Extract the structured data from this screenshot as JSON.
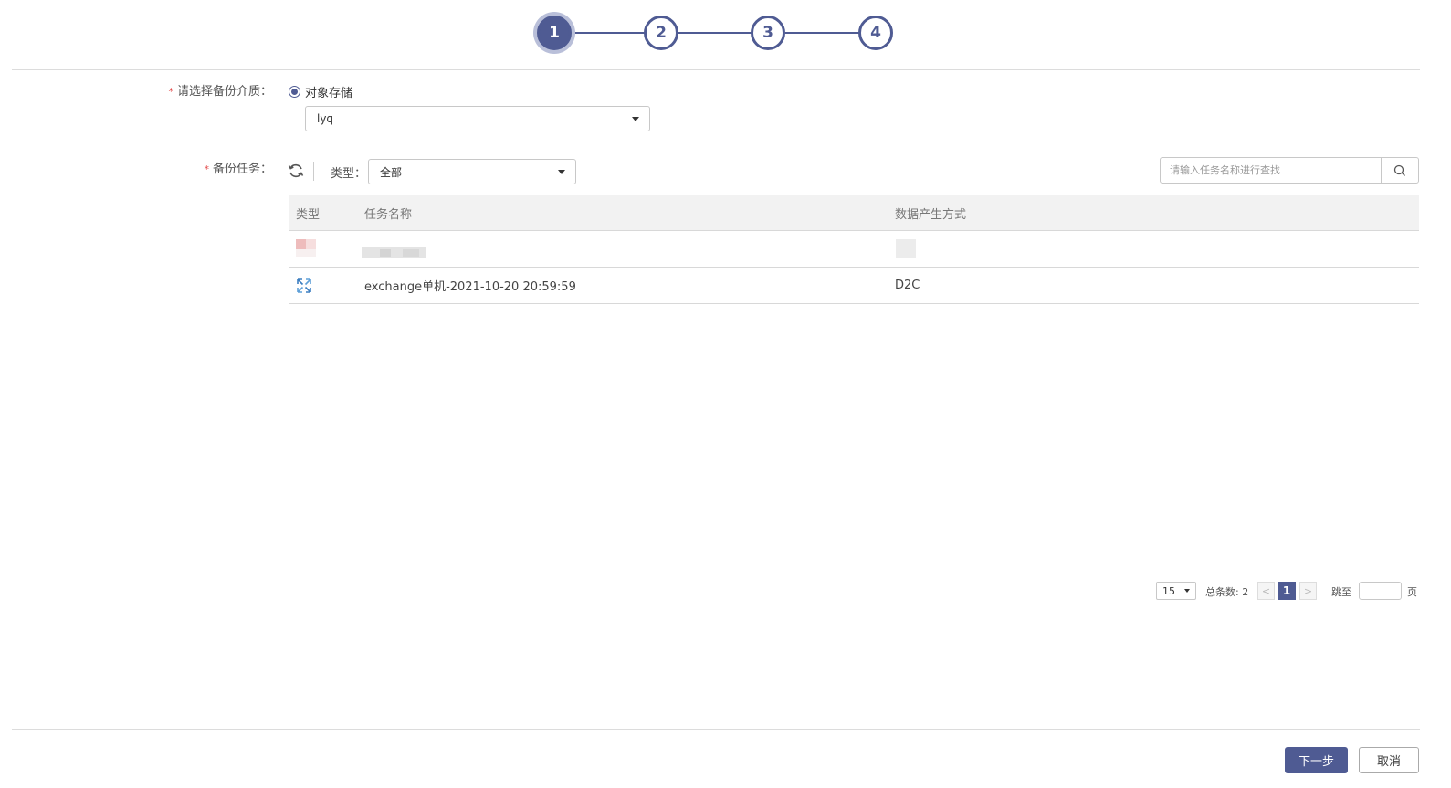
{
  "stepper": {
    "steps": [
      "1",
      "2",
      "3",
      "4"
    ],
    "active_step": 1
  },
  "medium": {
    "label": "请选择备份介质：",
    "required_mark": "*",
    "radio_label": "对象存储",
    "storage_value": "lyq"
  },
  "tasks": {
    "label": "备份任务：",
    "required_mark": "*",
    "type_label": "类型：",
    "type_value": "全部",
    "search_placeholder": "请输入任务名称进行查找"
  },
  "table": {
    "columns": [
      "类型",
      "任务名称",
      "数据产生方式"
    ],
    "rows": [
      {
        "type_icon": "redacted-icon",
        "name": "",
        "mode": ""
      },
      {
        "type_icon": "exchange-icon",
        "name": "exchange单机-2021-10-20 20:59:59",
        "mode": "D2C"
      }
    ]
  },
  "pager": {
    "page_size": "15",
    "total_label": "总条数: 2",
    "prev": "<",
    "current_page": "1",
    "next": ">",
    "jump_label": "跳至",
    "page_suffix": "页"
  },
  "footer": {
    "next_label": "下一步",
    "cancel_label": "取消"
  },
  "colors": {
    "primary": "#4f5b93",
    "required": "#e34a4a"
  }
}
